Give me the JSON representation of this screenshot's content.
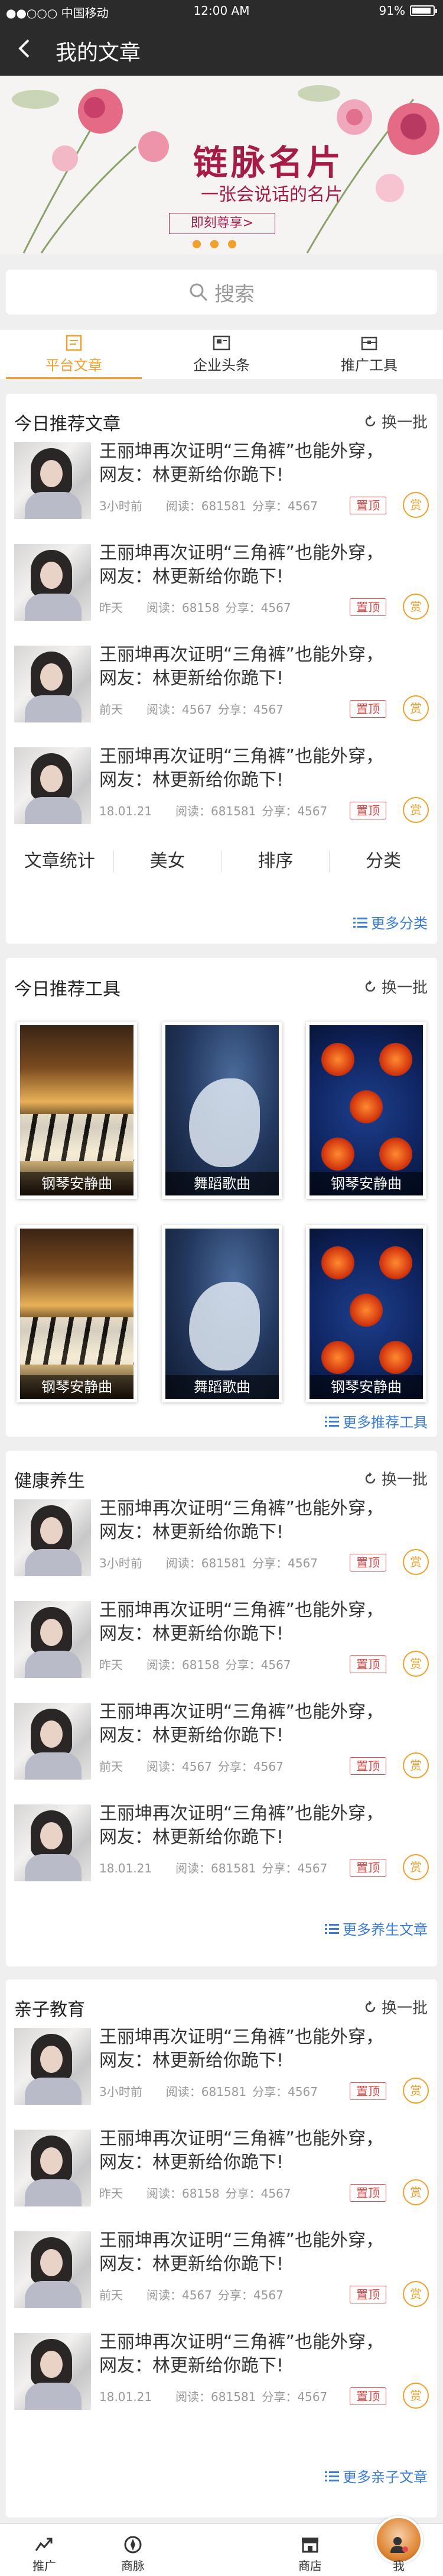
{
  "status": {
    "carrier": "●●○○○ 中国移动",
    "time": "12:00 AM",
    "battery": "91%"
  },
  "nav": {
    "title": "我的文章"
  },
  "banner": {
    "title": "链脉名片",
    "subtitle": "一张会说话的名片",
    "cta": "即刻尊享>"
  },
  "search": {
    "placeholder": "搜索"
  },
  "tabs": [
    "平台文章",
    "企业头条",
    "推广工具"
  ],
  "common": {
    "refresh": "换一批",
    "pin": "置顶",
    "coin": "赏"
  },
  "sections": {
    "today": {
      "title": "今日推荐文章",
      "articles": [
        {
          "title": "王丽坤再次证明“三角裤”也能外穿，网友：林更新给你跪下!",
          "time": "3小时前",
          "reads": "阅读：681581",
          "shares": "分享：4567"
        },
        {
          "title": "王丽坤再次证明“三角裤”也能外穿，网友：林更新给你跪下!",
          "time": "昨天",
          "reads": "阅读：68158",
          "shares": "分享：4567"
        },
        {
          "title": "王丽坤再次证明“三角裤”也能外穿，网友：林更新给你跪下!",
          "time": "前天",
          "reads": "阅读：4567",
          "shares": "分享：4567"
        },
        {
          "title": "王丽坤再次证明“三角裤”也能外穿，网友：林更新给你跪下!",
          "time": "18.01.21",
          "reads": "阅读：681581",
          "shares": "分享：4567"
        }
      ],
      "categories": [
        "文章统计",
        "美女",
        "排序",
        "分类"
      ],
      "more": "更多分类"
    },
    "tools": {
      "title": "今日推荐工具",
      "items": [
        "钢琴安静曲",
        "舞蹈歌曲",
        "钢琴安静曲",
        "钢琴安静曲",
        "舞蹈歌曲",
        "钢琴安静曲"
      ],
      "more": "更多推荐工具"
    },
    "health": {
      "title": "健康养生",
      "articles": [
        {
          "title": "王丽坤再次证明“三角裤”也能外穿，网友：林更新给你跪下!",
          "time": "3小时前",
          "reads": "阅读：681581",
          "shares": "分享：4567"
        },
        {
          "title": "王丽坤再次证明“三角裤”也能外穿，网友：林更新给你跪下!",
          "time": "昨天",
          "reads": "阅读：68158",
          "shares": "分享：4567"
        },
        {
          "title": "王丽坤再次证明“三角裤”也能外穿，网友：林更新给你跪下!",
          "time": "前天",
          "reads": "阅读：4567",
          "shares": "分享：4567"
        },
        {
          "title": "王丽坤再次证明“三角裤”也能外穿，网友：林更新给你跪下!",
          "time": "18.01.21",
          "reads": "阅读：681581",
          "shares": "分享：4567"
        }
      ],
      "more": "更多养生文章"
    },
    "parent": {
      "title": "亲子教育",
      "articles": [
        {
          "title": "王丽坤再次证明“三角裤”也能外穿，网友：林更新给你跪下!",
          "time": "3小时前",
          "reads": "阅读：681581",
          "shares": "分享：4567"
        },
        {
          "title": "王丽坤再次证明“三角裤”也能外穿，网友：林更新给你跪下!",
          "time": "昨天",
          "reads": "阅读：68158",
          "shares": "分享：4567"
        },
        {
          "title": "王丽坤再次证明“三角裤”也能外穿，网友：林更新给你跪下!",
          "time": "前天",
          "reads": "阅读：4567",
          "shares": "分享：4567"
        },
        {
          "title": "王丽坤再次证明“三角裤”也能外穿，网友：林更新给你跪下!",
          "time": "18.01.21",
          "reads": "阅读：681581",
          "shares": "分享：4567"
        }
      ],
      "more": "更多亲子文章"
    }
  },
  "footer": [
    "推广",
    "商脉",
    "商店",
    "我"
  ]
}
